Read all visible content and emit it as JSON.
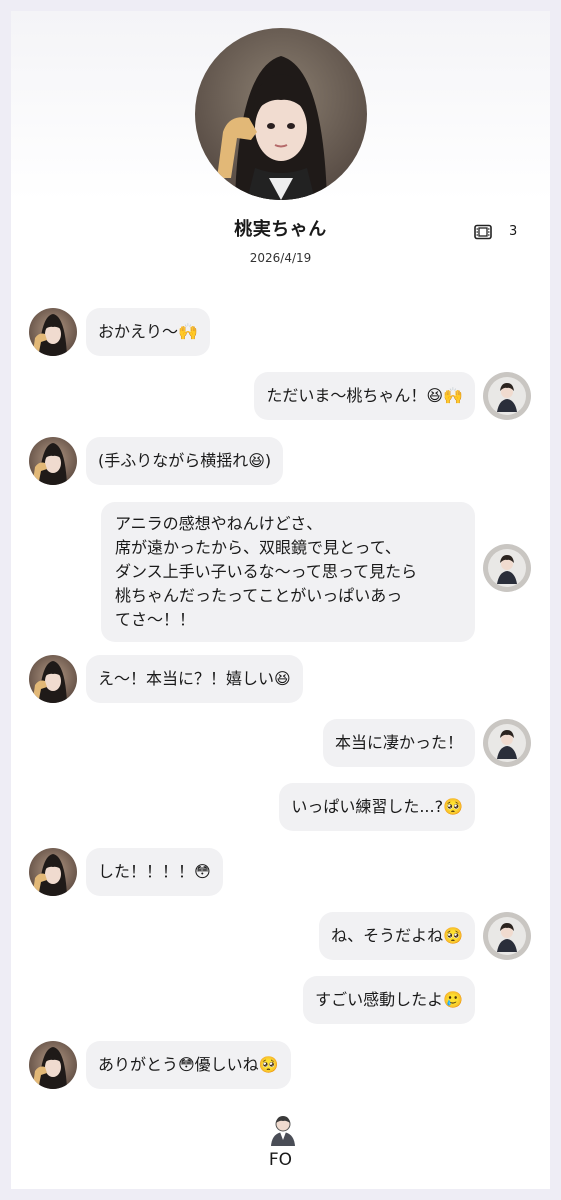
{
  "profile": {
    "name": "桃実ちゃん",
    "date": "2026/4/19",
    "count": "3",
    "count_icon": "film-icon"
  },
  "messages": [
    {
      "side": "left",
      "text": "おかえり〜🙌"
    },
    {
      "side": "right",
      "text": "ただいま〜桃ちゃん！😆🙌"
    },
    {
      "side": "left",
      "text": "(手ふりながら横揺れ😆)"
    },
    {
      "side": "right",
      "lines": [
        "アニラの感想やねんけどさ、",
        "席が遠かったから、双眼鏡で見とって、",
        "ダンス上手い子いるな〜って思って見たら",
        "桃ちゃんだったってことがいっぱいあっ",
        "てさ〜！！"
      ]
    },
    {
      "side": "left",
      "text": "え〜！本当に？！嬉しい😆"
    },
    {
      "side": "right",
      "text": "本当に凄かった！"
    },
    {
      "side": "right",
      "text": "いっぱい練習した...?🥺"
    },
    {
      "side": "left",
      "text": "した！！！！😳"
    },
    {
      "side": "right",
      "text": "ね、そうだよね🥺"
    },
    {
      "side": "right",
      "text": "すごい感動したよ🥲"
    },
    {
      "side": "left",
      "text": "ありがとう😳優しいね🥺"
    }
  ],
  "footer": {
    "label": "FO",
    "icon": "person-icon"
  }
}
